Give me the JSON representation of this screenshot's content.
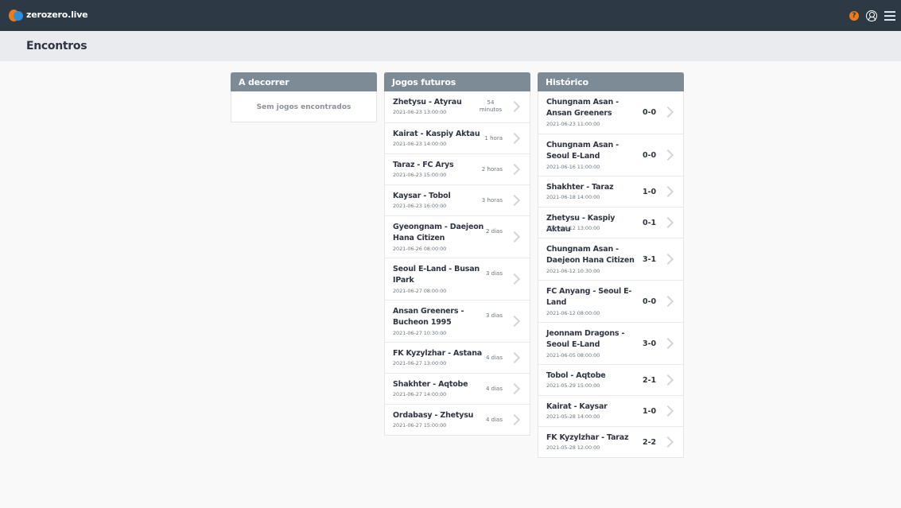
{
  "app": {
    "brand": "zerozero.live"
  },
  "header": {
    "help_glyph": "?"
  },
  "page": {
    "title": "Encontros"
  },
  "panels": {
    "live": {
      "title": "A decorrer",
      "empty": "Sem jogos encontrados"
    },
    "upcoming": {
      "title": "Jogos futuros",
      "rows": [
        {
          "title": "Zhetysu - Atyrau",
          "date": "2021-06-23 13:00:00",
          "when": "54 minutos"
        },
        {
          "title": "Kairat - Kaspiy Aktau",
          "date": "2021-06-23 14:00:00",
          "when": "1 hora"
        },
        {
          "title": "Taraz - FC Arys",
          "date": "2021-06-23 15:00:00",
          "when": "2 horas"
        },
        {
          "title": "Kaysar - Tobol",
          "date": "2021-06-23 16:00:00",
          "when": "3 horas"
        },
        {
          "title": "Gyeongnam - Daejeon Hana Citizen",
          "date": "2021-06-26 08:00:00",
          "when": "2 dias"
        },
        {
          "title": "Seoul E-Land - Busan IPark",
          "date": "2021-06-27 08:00:00",
          "when": "3 dias"
        },
        {
          "title": "Ansan Greeners - Bucheon 1995",
          "date": "2021-06-27 10:30:00",
          "when": "3 dias"
        },
        {
          "title": "FK Kyzylzhar - Astana",
          "date": "2021-06-27 13:00:00",
          "when": "4 dias"
        },
        {
          "title": "Shakhter - Aqtobe",
          "date": "2021-06-27 14:00:00",
          "when": "4 dias"
        },
        {
          "title": "Ordabasy - Zhetysu",
          "date": "2021-06-27 15:00:00",
          "when": "4 dias"
        }
      ]
    },
    "history": {
      "title": "Histórico",
      "rows": [
        {
          "title": "Chungnam Asan - Ansan Greeners",
          "date": "2021-06-23 11:00:00",
          "score": "0-0"
        },
        {
          "title": "Chungnam Asan - Seoul E-Land",
          "date": "2021-06-16 11:00:00",
          "score": "0-0"
        },
        {
          "title": "Shakhter - Taraz",
          "date": "2021-06-18 14:00:00",
          "score": "1-0"
        },
        {
          "title": "Zhetysu - Kaspiy Aktau",
          "date": "2021-06-12 13:00:00",
          "score": "0-1"
        },
        {
          "title": "Chungnam Asan - Daejeon Hana Citizen",
          "date": "2021-06-12 10:30:00",
          "score": "3-1"
        },
        {
          "title": "FC Anyang - Seoul E-Land",
          "date": "2021-06-12 08:00:00",
          "score": "0-0"
        },
        {
          "title": "Jeonnam Dragons - Seoul E-Land",
          "date": "2021-06-05 08:00:00",
          "score": "3-0"
        },
        {
          "title": "Tobol - Aqtobe",
          "date": "2021-05-29 15:00:00",
          "score": "2-1"
        },
        {
          "title": "Kairat - Kaysar",
          "date": "2021-05-28 14:00:00",
          "score": "1-0"
        },
        {
          "title": "FK Kyzylzhar - Taraz",
          "date": "2021-05-28 12:00:00",
          "score": "2-2"
        }
      ]
    }
  },
  "icons": [
    "logo-icon",
    "help-icon",
    "user-icon",
    "menu-icon",
    "chevron-right-icon"
  ],
  "colors": {
    "topbar": "#2d3a46",
    "panel_header": "#7d8b97",
    "accent": "#f07b16",
    "logo_blue": "#2d8fd8"
  }
}
